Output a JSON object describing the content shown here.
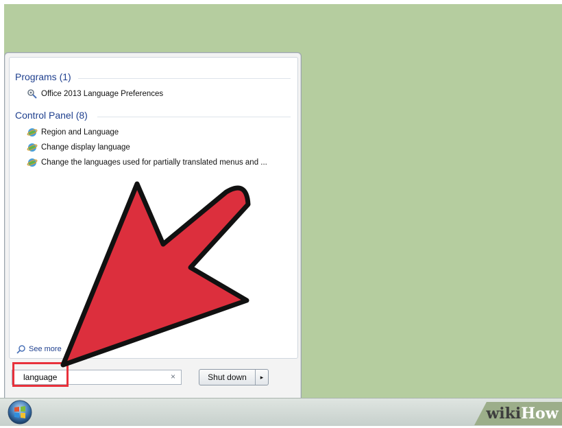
{
  "start_menu": {
    "programs_header": "Programs (1)",
    "programs": [
      {
        "label": "Office 2013 Language Preferences",
        "icon": "office-settings-icon"
      }
    ],
    "control_panel_header": "Control Panel (8)",
    "control_panel": [
      {
        "label": "Region and Language",
        "icon": "control-panel-globe-icon"
      },
      {
        "label": "Change display language",
        "icon": "control-panel-globe-icon"
      },
      {
        "label": "Change the languages used for partially translated menus and ...",
        "icon": "control-panel-globe-icon"
      }
    ],
    "see_more": "See more",
    "search": {
      "value": "language",
      "clear_glyph": "×"
    },
    "shutdown": {
      "label": "Shut down",
      "arrow": "▸"
    }
  },
  "watermark": {
    "part1": "wiki",
    "part2": "How"
  },
  "colors": {
    "desktop": "#b5cd9f",
    "header_blue": "#1e3f8e",
    "highlight_red": "#e8313b",
    "arrow_red": "#dc2f3d"
  }
}
